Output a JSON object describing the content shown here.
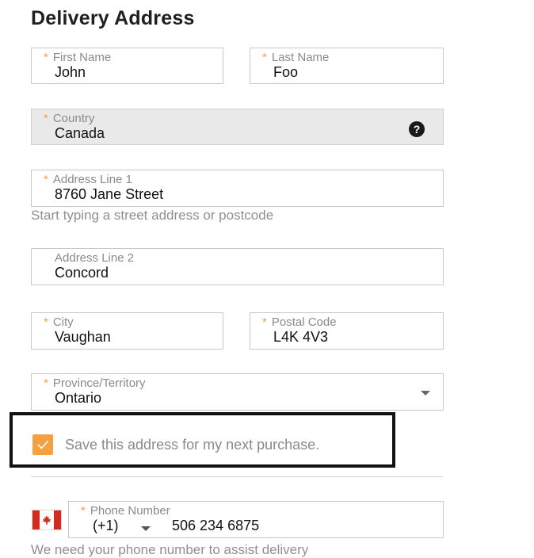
{
  "page_title": "Delivery Address",
  "fields": {
    "first_name": {
      "label": "First Name",
      "value": "John"
    },
    "last_name": {
      "label": "Last Name",
      "value": "Foo"
    },
    "country": {
      "label": "Country",
      "value": "Canada",
      "help_glyph": "?"
    },
    "address1": {
      "label": "Address Line 1",
      "value": "8760 Jane Street",
      "hint": "Start typing a street address or postcode"
    },
    "address2": {
      "label": "Address Line 2",
      "value": "Concord"
    },
    "city": {
      "label": "City",
      "value": "Vaughan"
    },
    "postal_code": {
      "label": "Postal Code",
      "value": "L4K 4V3"
    },
    "province": {
      "label": "Province/Territory",
      "value": "Ontario"
    },
    "phone": {
      "label": "Phone Number",
      "country_code": "(+1)",
      "value": "506 234 6875"
    }
  },
  "required_mark": "*",
  "save_address": {
    "label": "Save this address for my next purchase.",
    "checked": true
  },
  "phone_note": "We need your phone number to assist delivery",
  "colors": {
    "accent": "#f5a142",
    "required": "#f0a14a",
    "flag_red": "#d52b1e"
  },
  "icons": {
    "help": "question-circle-icon",
    "dropdown": "caret-down-icon",
    "flag": "canada-flag-icon",
    "check": "check-icon"
  }
}
